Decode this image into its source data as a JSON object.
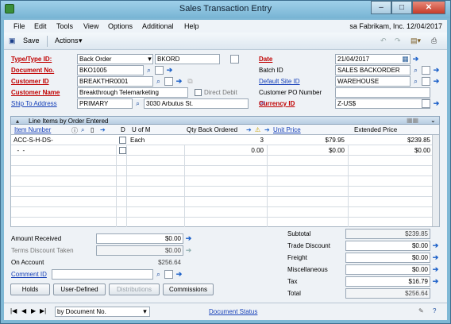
{
  "window": {
    "title": "Sales Transaction Entry"
  },
  "menu": {
    "items": [
      "File",
      "Edit",
      "Tools",
      "View",
      "Options",
      "Additional",
      "Help"
    ],
    "right_text": "sa  Fabrikam, Inc.  12/04/2017"
  },
  "toolbar": {
    "save_label": "Save",
    "actions_label": "Actions"
  },
  "header": {
    "type_label": "Type/Type ID:",
    "type_value": "Back Order",
    "type_id_value": "BKORD",
    "docnum_label": "Document No.",
    "docnum_value": "BKO1005",
    "customer_id_label": "Customer ID",
    "customer_id_value": "BREAKTHR0001",
    "customer_name_label": "Customer Name",
    "customer_name_value": "Breakthrough Telemarketing",
    "direct_debit_label": "Direct Debit",
    "ship_to_label": "Ship To Address",
    "ship_to_value": "PRIMARY",
    "ship_to_address": "3030 Arbutus St.",
    "date_label": "Date",
    "date_value": "21/04/2017",
    "batch_label": "Batch ID",
    "batch_value": "SALES BACKORDER",
    "site_label": "Default Site ID",
    "site_value": "WAREHOUSE",
    "po_label": "Customer PO Number",
    "po_value": "",
    "currency_label": "Currency ID",
    "currency_value": "Z-US$"
  },
  "grid": {
    "title": "Line Items by Order Entered",
    "columns": {
      "item": "Item Number",
      "d": "D",
      "uom": "U of M",
      "qty": "Qty Back Ordered",
      "price": "Unit Price",
      "ext": "Extended Price"
    },
    "rows": [
      {
        "item": "ACC-S-H-DS-",
        "uom": "Each",
        "qty": "3",
        "price": "$79.95",
        "ext": "$239.85"
      },
      {
        "item": "  -  -",
        "uom": "",
        "qty": "0.00",
        "price": "$0.00",
        "ext": "$0.00"
      }
    ]
  },
  "bottom_left": {
    "amount_received_label": "Amount Received",
    "amount_received_value": "$0.00",
    "terms_label": "Terms Discount Taken",
    "terms_value": "$0.00",
    "on_account_label": "On Account",
    "on_account_value": "$256.64",
    "comment_label": "Comment ID",
    "comment_value": ""
  },
  "totals": {
    "subtotal_label": "Subtotal",
    "subtotal": "$239.85",
    "trade_label": "Trade Discount",
    "trade": "$0.00",
    "freight_label": "Freight",
    "freight": "$0.00",
    "misc_label": "Miscellaneous",
    "misc": "$0.00",
    "tax_label": "Tax",
    "tax": "$16.79",
    "total_label": "Total",
    "total": "$256.64"
  },
  "buttons": {
    "holds": "Holds",
    "user_defined": "User-Defined",
    "distributions": "Distributions",
    "commissions": "Commissions"
  },
  "status": {
    "sort_value": "by Document No.",
    "doc_status": "Document Status"
  }
}
